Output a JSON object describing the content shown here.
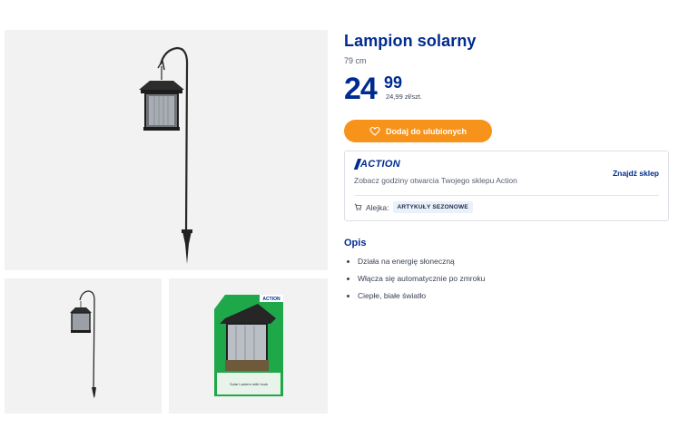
{
  "gallery": {
    "box_brand": "ACTION",
    "box_caption": "Solar Lantern with hook"
  },
  "product": {
    "title": "Lampion solarny",
    "size": "79 cm",
    "price_int": "24",
    "price_dec": "99",
    "unit_price": "24,99 zł/szt.",
    "favorite_label": "Dodaj do ulubionych"
  },
  "store": {
    "brand": "ACTION",
    "hours_text": "Zobacz godziny otwarcia Twojego sklepu Action",
    "find_label": "Znajdź sklep",
    "aisle_label": "Alejka:",
    "aisle_value": "ARTYKUŁY SEZONOWE"
  },
  "description": {
    "title": "Opis",
    "items": [
      "Działa na energię słoneczną",
      "Włącza się automatycznie po zmroku",
      "Ciepłe, białe światło"
    ]
  },
  "colors": {
    "brand_blue": "#002b8f",
    "accent_orange": "#f7931a",
    "gallery_bg": "#f2f2f2",
    "packaging_green": "#1fa84a"
  },
  "icons": [
    "heart-icon",
    "cart-icon",
    "action-logo"
  ]
}
